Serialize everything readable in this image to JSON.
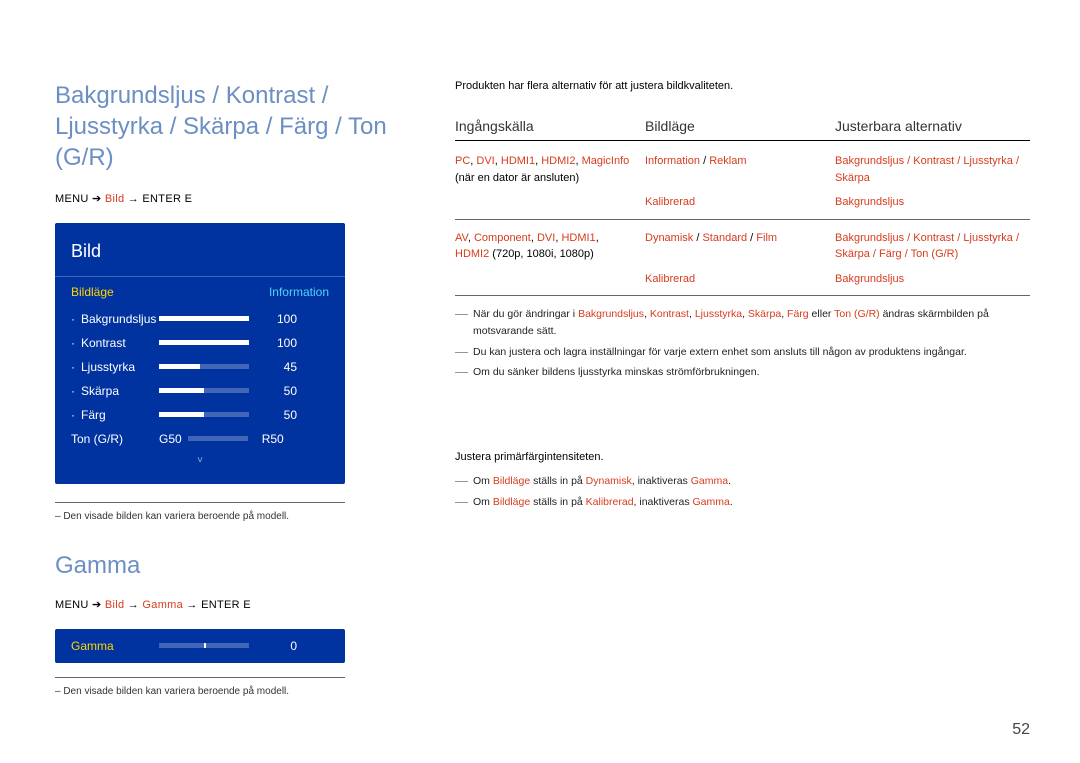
{
  "left": {
    "heading": "Bakgrundsljus / Kontrast / Ljusstyrka / Skärpa / Färg / Ton (G/R)",
    "menuPath": {
      "prefix": "MENU",
      "sep1": "➔",
      "item1": "Bild",
      "sep2": "→",
      "tail": "ENTER",
      "enterGlyph": "E"
    },
    "osd": {
      "title": "Bild",
      "subrow": {
        "left": "Bildläge",
        "right": "Information"
      },
      "items": [
        {
          "label": "Bakgrundsljus",
          "value": "100",
          "fill": 100
        },
        {
          "label": "Kontrast",
          "value": "100",
          "fill": 100
        },
        {
          "label": "Ljusstyrka",
          "value": "45",
          "fill": 45
        },
        {
          "label": "Skärpa",
          "value": "50",
          "fill": 50
        },
        {
          "label": "Färg",
          "value": "50",
          "fill": 50
        }
      ],
      "tone": {
        "label": "Ton (G/R)",
        "g": "G50",
        "r": "R50"
      },
      "chevron": "˅"
    },
    "footnote": "– Den visade bilden kan variera beroende på modell."
  },
  "gamma": {
    "heading": "Gamma",
    "menuPath": {
      "prefix": "MENU",
      "sep1": "➔",
      "item1": "Bild",
      "sep2": "→",
      "item2": "Gamma",
      "sep3": "→",
      "tail": "ENTER",
      "enterGlyph": "E"
    },
    "osd": {
      "label": "Gamma",
      "value": "0"
    },
    "footnote": "– Den visade bilden kan variera beroende på modell."
  },
  "right": {
    "intro": "Produkten har flera alternativ för att justera bildkvaliteten.",
    "columns": {
      "c1": "Ingångskälla",
      "c2": "Bildläge",
      "c3": "Justerbara alternativ"
    },
    "rows": [
      {
        "c1_hl": "PC",
        "c1_s1": ", ",
        "c1_hl2": "DVI",
        "c1_s2": ", ",
        "c1_hl3": "HDMI1",
        "c1_s3": ", ",
        "c1_hl4": "HDMI2",
        "c1_s4": ", ",
        "c1_hl5": "MagicInfo",
        "c1_tail": "(när en dator är ansluten)",
        "c2a": "Information",
        "c2s": " / ",
        "c2b": "Reklam",
        "c3": "Bakgrundsljus / Kontrast / Ljusstyrka / Skärpa"
      },
      {
        "c1": "",
        "c2a": "Kalibrerad",
        "c3a": "Bakgrundsljus"
      },
      {
        "c1a": "AV",
        "c1b": "Component",
        "c1c": "DVI",
        "c1d": "HDMI1",
        "c1e": "HDMI2",
        "c1tail": " (720p, 1080i, 1080p)",
        "c2a": "Dynamisk",
        "c2b": "Standard",
        "c2c": "Film",
        "c3": "Bakgrundsljus / Kontrast / Ljusstyrka / Skärpa / Färg / Ton (G/R)"
      },
      {
        "c1": "",
        "c2a": "Kalibrerad",
        "c3a": "Bakgrundsljus"
      }
    ],
    "notes": [
      {
        "pre": "När du gör ändringar i ",
        "hl": "Bakgrundsljus",
        "mid1": ", ",
        "hl2": "Kontrast",
        "mid2": ", ",
        "hl3": "Ljusstyrka",
        "mid3": ", ",
        "hl4": "Skärpa",
        "mid4": ", ",
        "hl5": "Färg",
        "mid5": " eller ",
        "hl6": "Ton (G/R)",
        "tail": " ändras skärmbilden på motsvarande sätt."
      },
      {
        "full": "Du kan justera och lagra inställningar för varje extern enhet som ansluts till någon av produktens ingångar."
      },
      {
        "full": "Om du sänker bildens ljusstyrka minskas strömförbrukningen."
      }
    ],
    "gammaSection": {
      "intro": "Justera primärfärgintensiteten.",
      "notes": [
        {
          "pre": "Om ",
          "hl": "Bildläge",
          "mid1": " ställs in på ",
          "hl2": "Dynamisk",
          "mid2": ", inaktiveras ",
          "hl3": "Gamma",
          "tail": "."
        },
        {
          "pre": "Om ",
          "hl": "Bildläge",
          "mid1": " ställs in på ",
          "hl2": "Kalibrerad",
          "mid2": ", inaktiveras ",
          "hl3": "Gamma",
          "tail": "."
        }
      ]
    }
  },
  "pageNumber": "52"
}
